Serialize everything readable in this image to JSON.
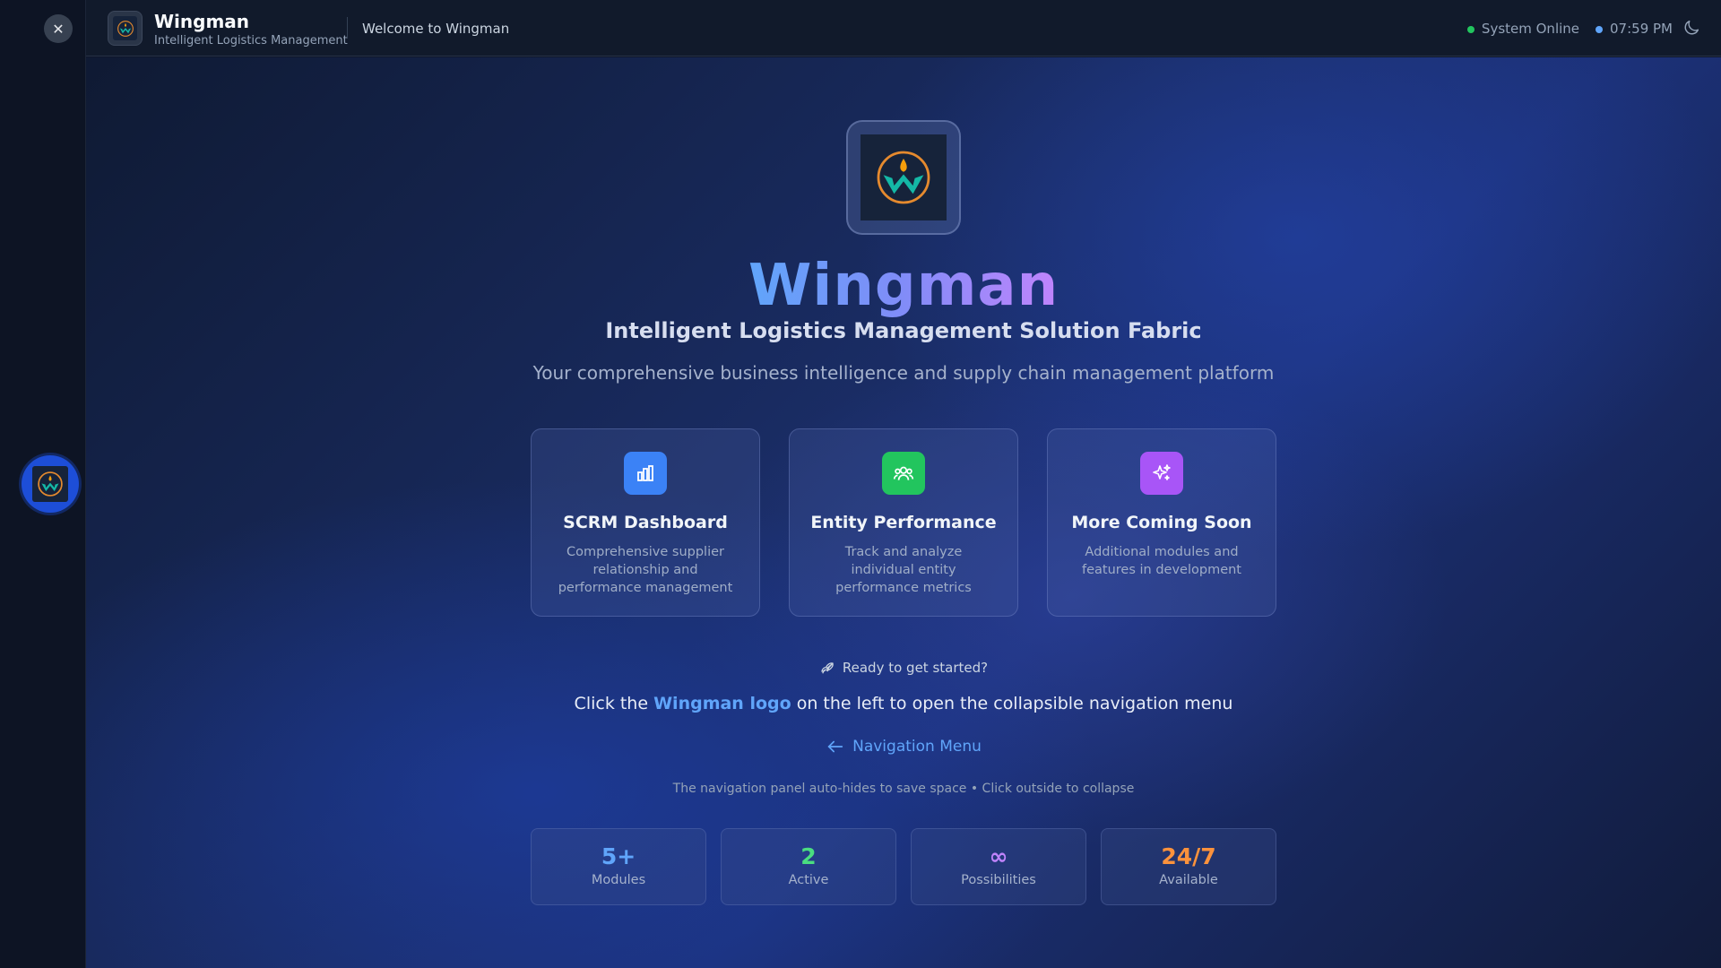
{
  "sidebar": {
    "close_label": "✕",
    "logo_icon": "wingman-logo"
  },
  "header": {
    "title": "Wingman",
    "subtitle": "Intelligent Logistics Management",
    "page_title": "Welcome to Wingman",
    "status_text": "System Online",
    "status_color": "#22c55e",
    "time": "07:59 PM",
    "time_color": "#60a5fa",
    "theme_icon": "moon-icon"
  },
  "hero": {
    "title": "Wingman",
    "subtitle": "Intelligent Logistics Management Solution Fabric",
    "description": "Your comprehensive business intelligence and supply chain management platform"
  },
  "cards": [
    {
      "title": "SCRM Dashboard",
      "description": "Comprehensive supplier relationship and performance management",
      "icon": "bar-chart-icon",
      "color": "#3b82f6"
    },
    {
      "title": "Entity Performance",
      "description": "Track and analyze individual entity performance metrics",
      "icon": "users-icon",
      "color": "#22c55e"
    },
    {
      "title": "More Coming Soon",
      "description": "Additional modules and features in development",
      "icon": "sparkles-icon",
      "color": "#a855f7"
    }
  ],
  "cta": {
    "ready": "Ready to get started?",
    "click_prefix": "Click the ",
    "click_highlight": "Wingman logo",
    "click_suffix": " on the left to open the collapsible navigation menu",
    "nav_link": "Navigation Menu",
    "note": "The navigation panel auto-hides to save space • Click outside to collapse"
  },
  "stats": [
    {
      "value": "5+",
      "label": "Modules",
      "color": "#60a5fa"
    },
    {
      "value": "2",
      "label": "Active",
      "color": "#4ade80"
    },
    {
      "value": "∞",
      "label": "Possibilities",
      "color": "#c084fc"
    },
    {
      "value": "24/7",
      "label": "Available",
      "color": "#fb923c"
    }
  ]
}
